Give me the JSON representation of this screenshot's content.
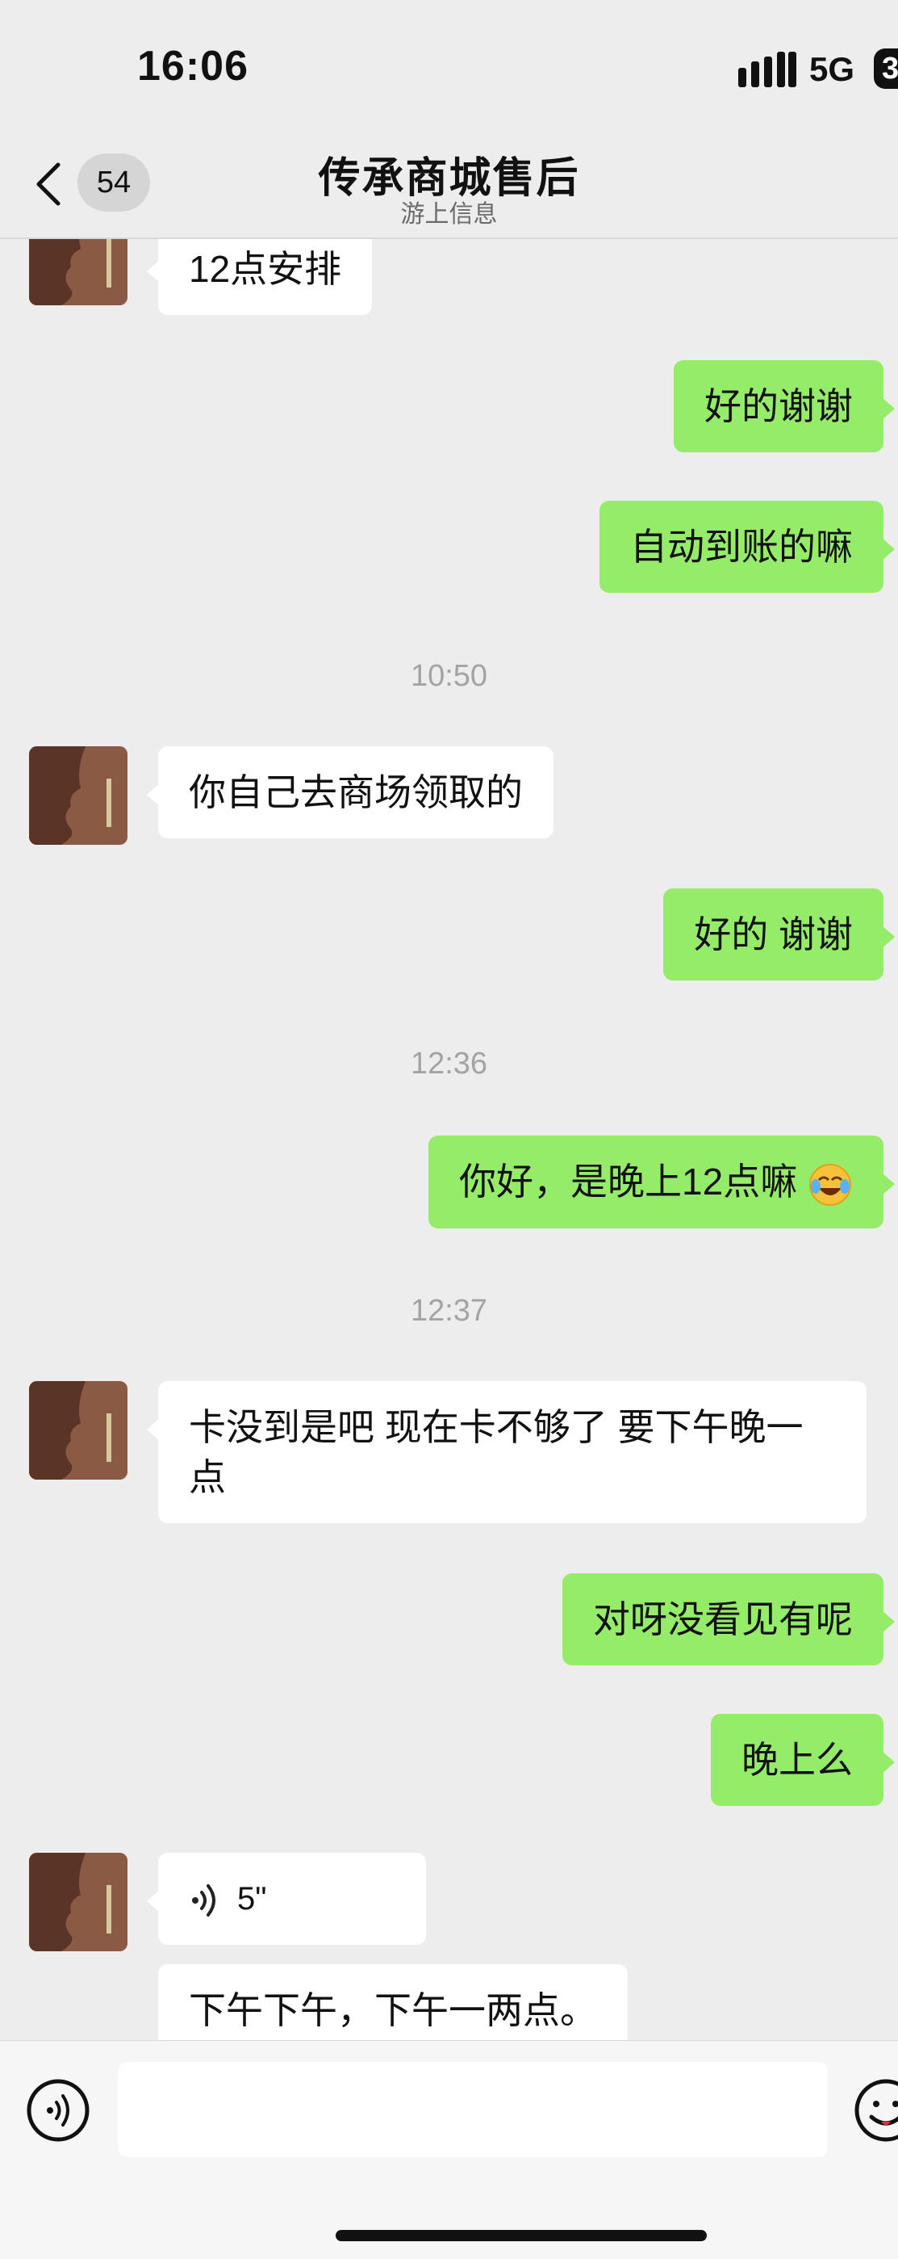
{
  "status": {
    "time": "16:06",
    "network": "5G",
    "battery": "3"
  },
  "nav": {
    "unread_count": "54",
    "title": "传承商城售后",
    "subtitle": "游上信息"
  },
  "messages": [
    {
      "text": "12点安排"
    },
    {
      "text": "好的谢谢"
    },
    {
      "text": "自动到账的嘛"
    },
    {
      "time": "10:50"
    },
    {
      "text": "你自己去商场领取的"
    },
    {
      "text": "好的  谢谢"
    },
    {
      "time": "12:36"
    },
    {
      "text": "你好，是晚上12点嘛"
    },
    {
      "time": "12:37"
    },
    {
      "text": "卡没到是吧 现在卡不够了 要下午晚一点"
    },
    {
      "text": "对呀没看见有呢"
    },
    {
      "text": "晚上么"
    },
    {
      "voice_duration": "5\""
    },
    {
      "text": "下午下午，下午一两点。"
    }
  ],
  "icons": {
    "back": "chevron-left-icon",
    "voice": "voice-wave-icon",
    "emoji_in_message": "laughing-tears-emoji-icon",
    "voice_toggle": "voice-input-icon",
    "emoji_picker": "emoji-icon"
  },
  "colors": {
    "outgoing_bubble": "#95ec69",
    "incoming_bubble": "#ffffff",
    "background": "#ededed"
  }
}
